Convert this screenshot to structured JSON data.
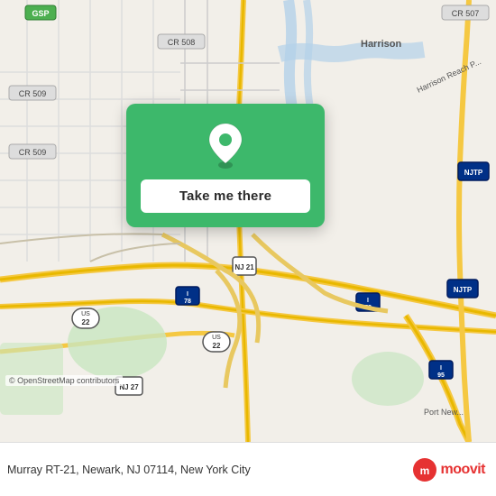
{
  "map": {
    "background_color": "#f2efe9",
    "center_lat": 40.726,
    "center_lng": -74.185
  },
  "card": {
    "background_color": "#3db86b",
    "pin_icon": "location-pin",
    "button_label": "Take me there"
  },
  "bottom_bar": {
    "address": "Murray RT-21, Newark, NJ 07114, New York City",
    "logo_text": "moovit"
  },
  "attribution": {
    "text": "© OpenStreetMap contributors"
  }
}
